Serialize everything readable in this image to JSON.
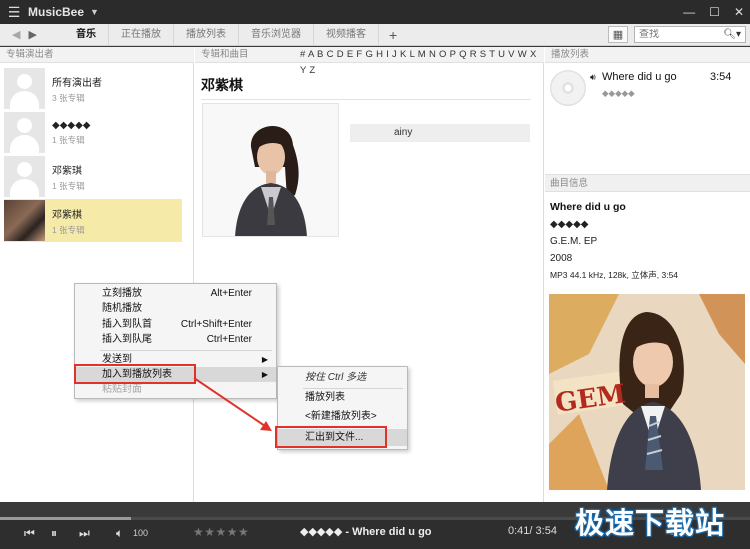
{
  "app": {
    "title": "MusicBee"
  },
  "nav": {
    "tabs": [
      "音乐",
      "正在播放",
      "播放列表",
      "音乐浏览器",
      "视频播客"
    ],
    "add": "+",
    "search_placeholder": "查找"
  },
  "artists_panel": {
    "header": "专辑演出者",
    "items": [
      {
        "name": "所有演出者",
        "count": "3 张专辑"
      },
      {
        "name": "\u0000\u0000\u0000\u0000\u0000",
        "count": "1 张专辑"
      },
      {
        "name": "邓紫琪",
        "count": "1 张专辑"
      },
      {
        "name": "邓紫棋",
        "count": "1 张专辑"
      }
    ]
  },
  "albums_panel": {
    "header": "专辑和曲目",
    "alphabet": "# A B C D E F G H I J K L M N O P Q R S T U V W X Y Z",
    "artist_title": "邓紫棋",
    "strip_text": "ainy"
  },
  "playlist_panel": {
    "header": "播放列表",
    "track": {
      "title": "Where did u go",
      "time": "3:54",
      "artist": "\u0000\u0000\u0000\u0000\u0000"
    }
  },
  "track_info": {
    "header": "曲目信息",
    "title": "Where did u go",
    "artist": "\u0000\u0000\u0000\u0000\u0000",
    "album": "G.E.M. EP",
    "year": "2008",
    "format": "MP3 44.1 kHz, 128k, 立体声, 3:54"
  },
  "context_menu": {
    "items": [
      {
        "label": "立刻播放",
        "shortcut": "Alt+Enter"
      },
      {
        "label": "随机播放",
        "shortcut": ""
      },
      {
        "label": "插入到队首",
        "shortcut": "Ctrl+Shift+Enter"
      },
      {
        "label": "插入到队尾",
        "shortcut": "Ctrl+Enter"
      },
      {
        "label": "发送到",
        "shortcut": ""
      },
      {
        "label": "加入到播放列表",
        "shortcut": ""
      },
      {
        "label": "粘贴封面",
        "shortcut": ""
      }
    ],
    "submenu": [
      "按住 Ctrl 多选",
      "播放列表",
      "<新建播放列表>",
      "汇出到文件..."
    ]
  },
  "player": {
    "volume": "100",
    "now_playing": "\u0000\u0000\u0000\u0000\u0000 - Where did u go",
    "time": "0:41/ 3:54",
    "progress": 0.175
  },
  "watermark": "极速下载站",
  "colors": {
    "selection": "#f6eaa9",
    "highlight_box": "#e0312a",
    "titlebar": "#2b2b2b"
  }
}
